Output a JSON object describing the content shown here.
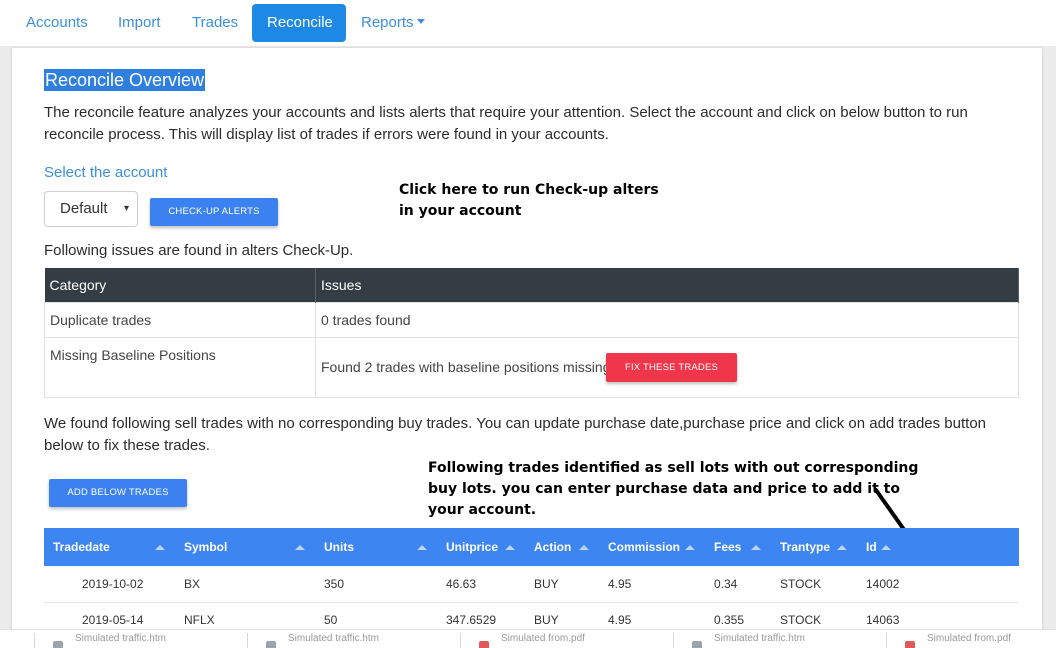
{
  "nav": {
    "items": [
      "Accounts",
      "Import",
      "Trades",
      "Reconcile",
      "Reports"
    ]
  },
  "overview": {
    "title": "Reconcile Overview",
    "description_line1": "The reconcile feature analyzes your accounts and lists alerts that require your attention. Select the account and click on below button to run",
    "description_line2": "reconcile process. This will display list of trades if errors were found in your accounts.",
    "select_label": "Select the account",
    "select_value": "Default",
    "checkup_button": "CHECK-UP ALERTS",
    "annotation_line1": "Click here to run Check-up alters",
    "annotation_line2": "in your account",
    "issues_intro": "Following issues are found in alters Check-Up."
  },
  "issues_table": {
    "headers": [
      "Category",
      "Issues"
    ],
    "rows": [
      {
        "category": "Duplicate trades",
        "issue": "0 trades found"
      },
      {
        "category": "Missing Baseline Positions",
        "issue": "Found 2 trades with baseline positions missing",
        "action": "FIX THESE TRADES"
      }
    ]
  },
  "sell_trades": {
    "description_line1": "We found following sell trades with no corresponding buy trades. You can update purchase date,purchase price and click on add trades button",
    "description_line2": "below to fix these trades.",
    "add_button": "ADD BELOW TRADES",
    "annotation_line1": "Following trades identified as sell lots with out corresponding",
    "annotation_line2": "buy lots. you can enter purchase data and price to add it to",
    "annotation_line3": "your account.",
    "headers": [
      "Tradedate",
      "Symbol",
      "Units",
      "Unitprice",
      "Action",
      "Commission",
      "Fees",
      "Trantype",
      "Id"
    ],
    "rows": [
      [
        "2019-10-02",
        "BX",
        "350",
        "46.63",
        "BUY",
        "4.95",
        "0.34",
        "STOCK",
        "14002"
      ],
      [
        "2019-05-14",
        "NFLX",
        "50",
        "347.6529",
        "BUY",
        "4.95",
        "0.355",
        "STOCK",
        "14063"
      ]
    ]
  },
  "taskbar": {
    "items": [
      "Simulated traffic.htm",
      "Simulated traffic.htm",
      "Simulated from.pdf",
      "Simulated traffic.htm",
      "Simulated from.pdf"
    ]
  },
  "colors": {
    "accent": "#1e88e5",
    "link": "#3d8fdc",
    "danger": "#f0364b",
    "table_header_dark": "#353d44",
    "table_header_blue": "#3d85f0"
  }
}
